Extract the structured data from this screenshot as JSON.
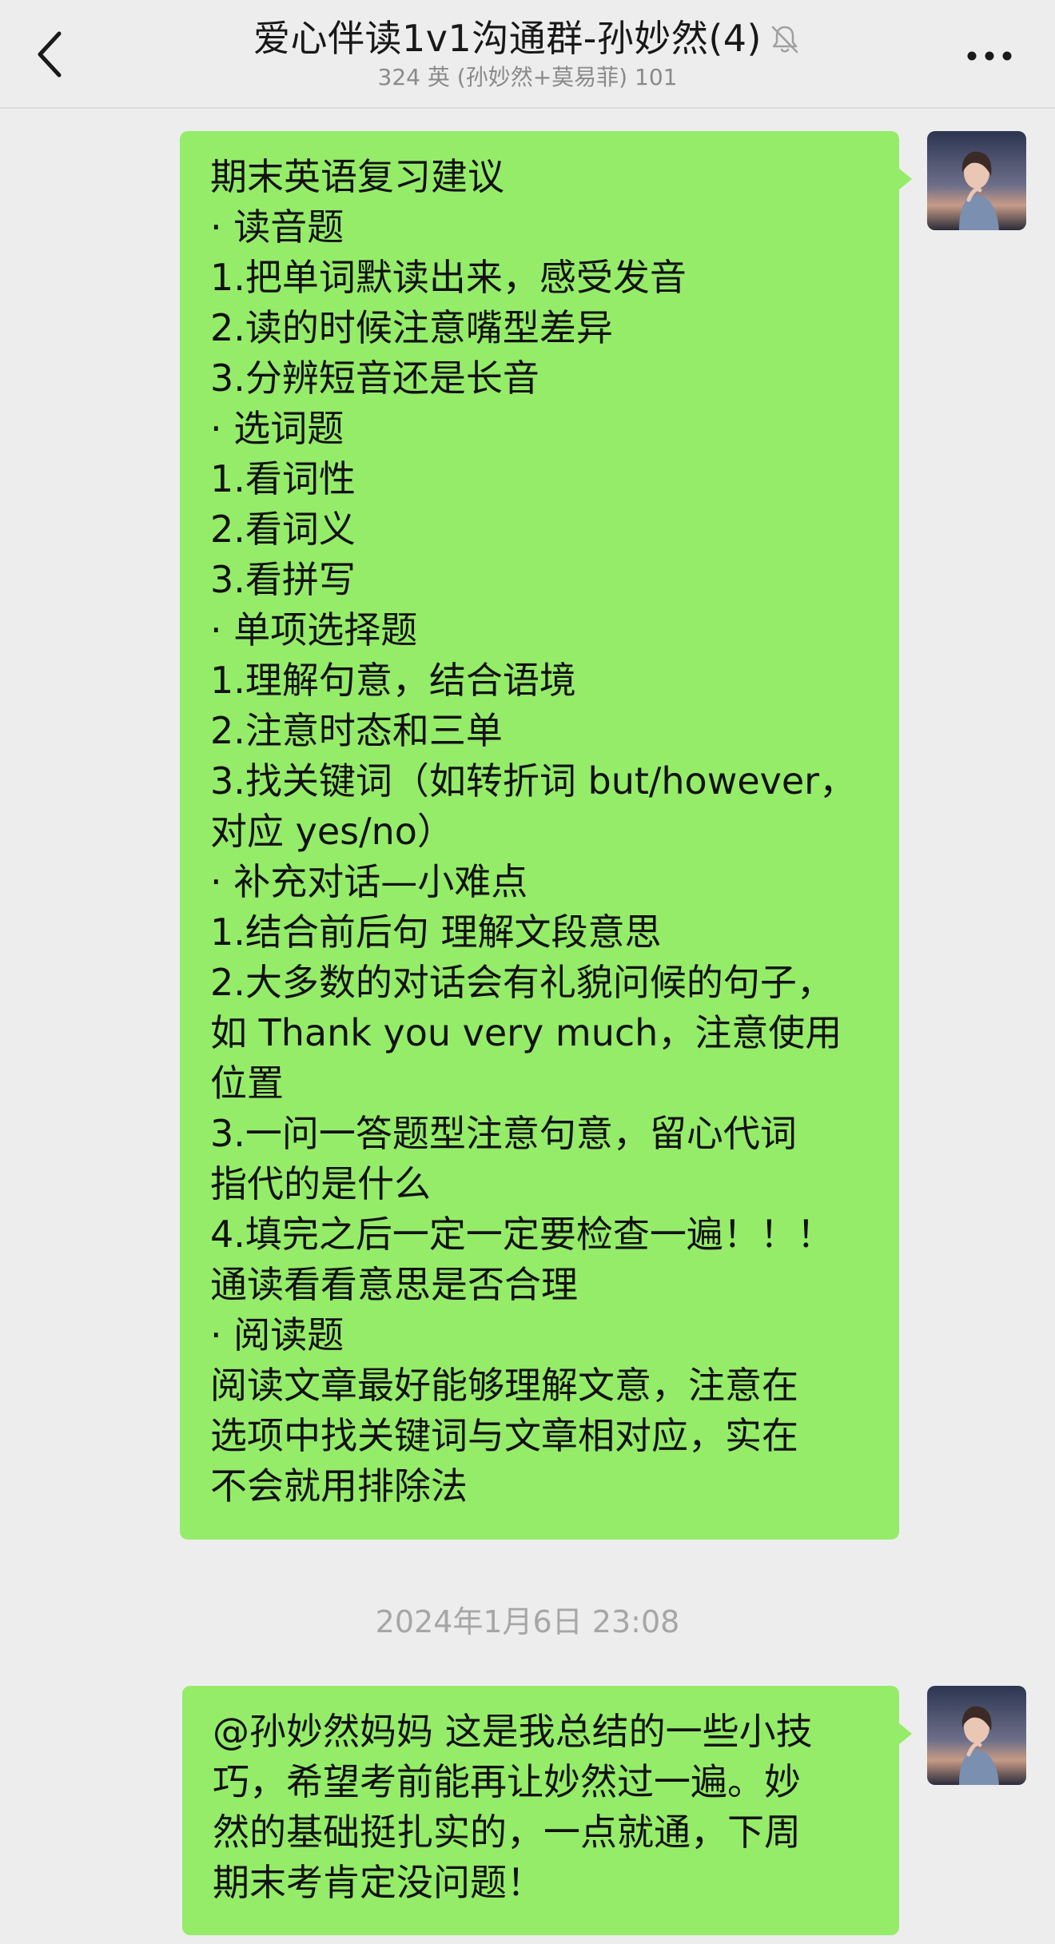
{
  "header": {
    "title": "爱心伴读1v1沟通群-孙妙然(4)",
    "subtitle": "324 英 (孙妙然+莫易菲) 101",
    "back_icon": "chevron-left-icon",
    "mute_icon": "bell-muted-icon",
    "more_icon": "more-dots-icon"
  },
  "messages": [
    {
      "sender": "self",
      "lines": [
        "期末英语复习建议",
        "· 读音题",
        "1.把单词默读出来，感受发音",
        "2.读的时候注意嘴型差异",
        "3.分辨短音还是长音",
        "· 选词题",
        "1.看词性",
        "2.看词义",
        "3.看拼写",
        "· 单项选择题",
        "1.理解句意，结合语境",
        "2.注意时态和三单",
        "3.找关键词（如转折词 but/however，",
        "对应 yes/no）",
        "· 补充对话—小难点",
        "1.结合前后句 理解文段意思",
        "2.大多数的对话会有礼貌问候的句子，",
        "如 Thank you very much，注意使用",
        "位置",
        "3.一问一答题型注意句意，留心代词",
        "指代的是什么",
        "4.填完之后一定一定要检查一遍！！！",
        "通读看看意思是否合理",
        "· 阅读题",
        "阅读文章最好能够理解文意，注意在",
        "选项中找关键词与文章相对应，实在",
        "不会就用排除法"
      ]
    },
    {
      "sender": "self",
      "lines": [
        "@孙妙然妈妈 这是我总结的一些小技",
        "巧，希望考前能再让妙然过一遍。妙",
        "然的基础挺扎实的，一点就通，下周",
        "期末考肯定没问题！"
      ]
    }
  ],
  "timestamp": "2024年1月6日 23:08",
  "colors": {
    "background": "#ededed",
    "bubble": "#95ec69",
    "timestamp": "#a6a6a6"
  }
}
